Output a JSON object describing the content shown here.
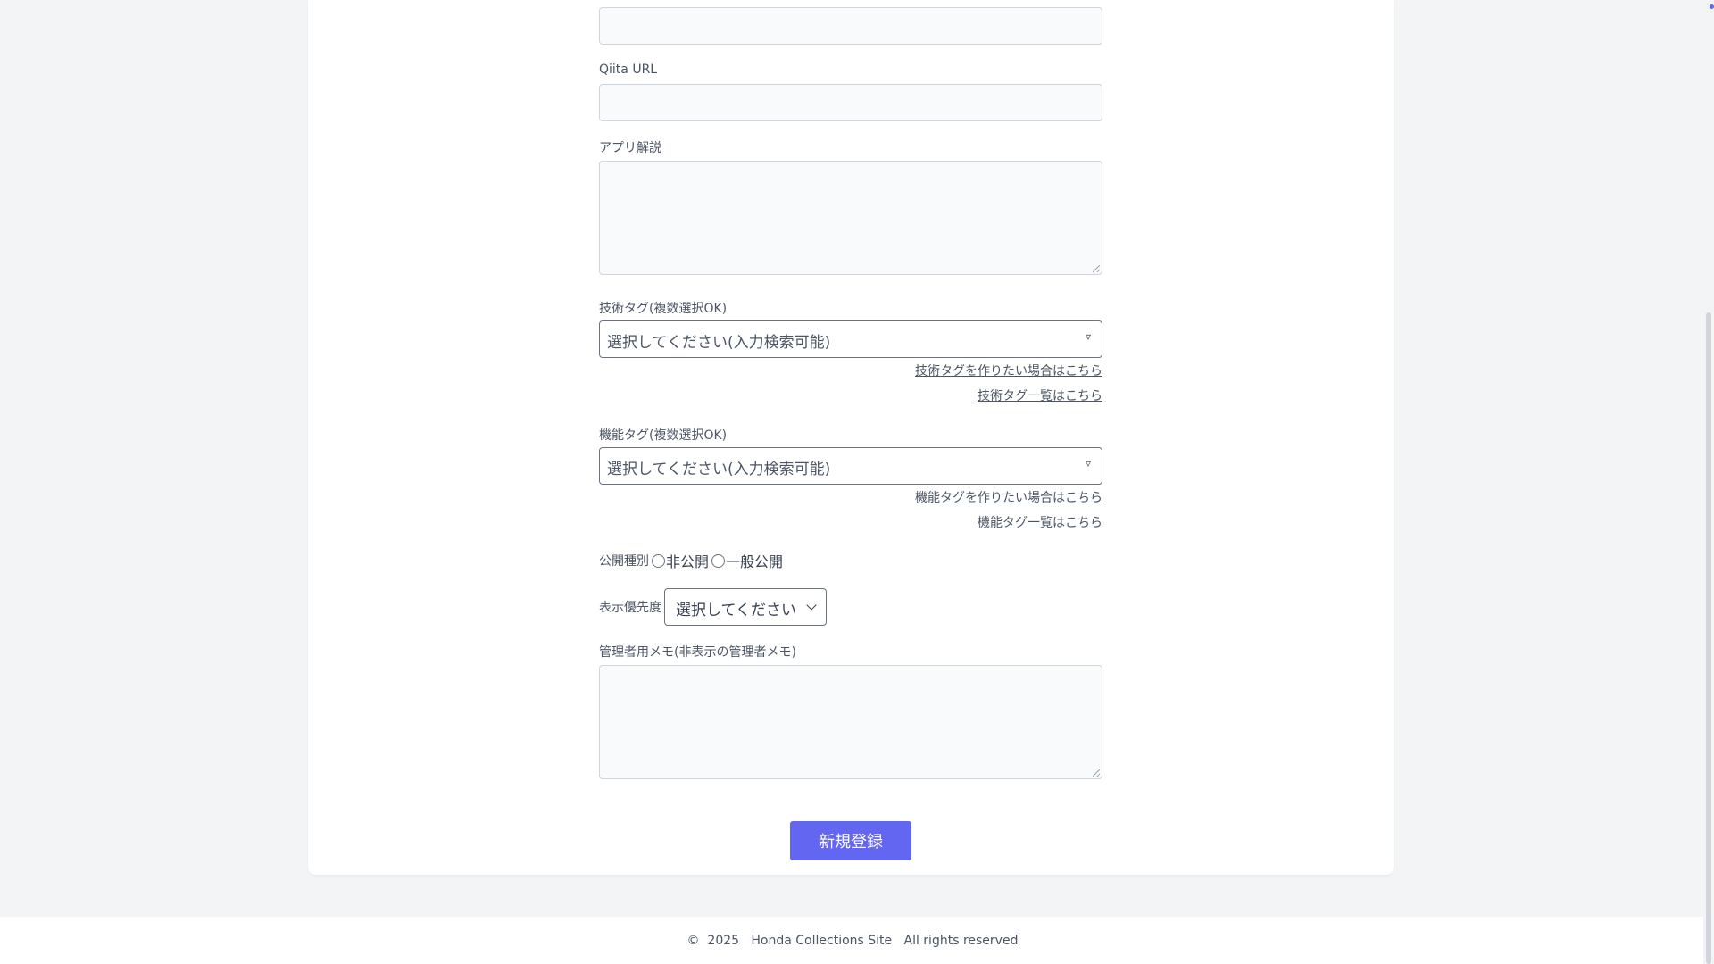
{
  "form": {
    "qiita_url": {
      "label": "Qiita URL",
      "value": ""
    },
    "app_description": {
      "label": "アプリ解説",
      "value": ""
    },
    "tech_tags": {
      "label": "技術タグ(複数選択OK)",
      "placeholder": "選択してください(入力検索可能)",
      "arrow_icon": "▿",
      "create_link": "技術タグを作りたい場合はこちら",
      "list_link": "技術タグ一覧はこちら"
    },
    "feature_tags": {
      "label": "機能タグ(複数選択OK)",
      "placeholder": "選択してください(入力検索可能)",
      "arrow_icon": "▿",
      "create_link": "機能タグを作りたい場合はこちら",
      "list_link": "機能タグ一覧はこちら"
    },
    "visibility": {
      "label": "公開種別",
      "options": [
        "非公開",
        "一般公開"
      ]
    },
    "priority": {
      "label": "表示優先度",
      "selected": "選択してください"
    },
    "admin_memo": {
      "label": "管理者用メモ(非表示の管理者メモ)",
      "value": ""
    },
    "submit_label": "新規登録"
  },
  "footer": {
    "text": "©  2025   Honda Collections Site   All rights reserved"
  },
  "colors": {
    "accent": "#6366f1",
    "background": "#f3f4f6"
  }
}
